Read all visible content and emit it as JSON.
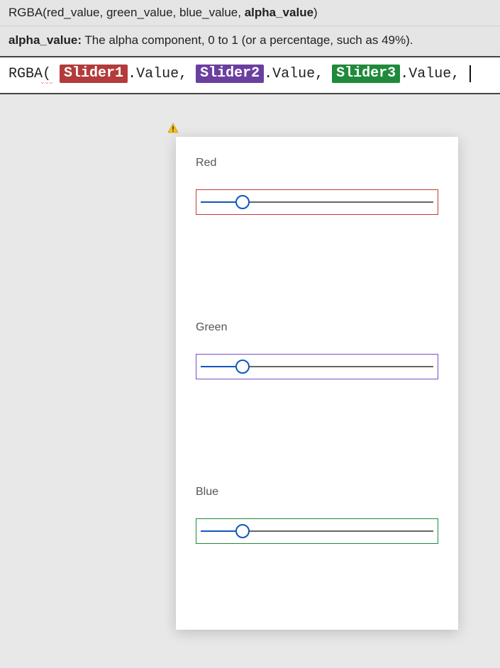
{
  "tooltip": {
    "signature_prefix": "RGBA(",
    "args": [
      "red_value",
      "green_value",
      "blue_value",
      "alpha_value"
    ],
    "signature_suffix": ")",
    "current_param_index": 3,
    "param_name": "alpha_value:",
    "param_desc": " The alpha component, 0 to 1 (or a percentage, such as 49%)."
  },
  "formula": {
    "func_name": "RGBA",
    "open_paren": "(",
    "space": " ",
    "slider1": "Slider1",
    "slider2": "Slider2",
    "slider3": "Slider3",
    "dot_value": ".Value",
    "comma": ","
  },
  "sliders": [
    {
      "label": "Red",
      "color_class": "red",
      "value_pct": 18
    },
    {
      "label": "Green",
      "color_class": "purple",
      "value_pct": 18
    },
    {
      "label": "Blue",
      "color_class": "green",
      "value_pct": 18
    }
  ],
  "icons": {
    "warning": "warning-icon"
  }
}
